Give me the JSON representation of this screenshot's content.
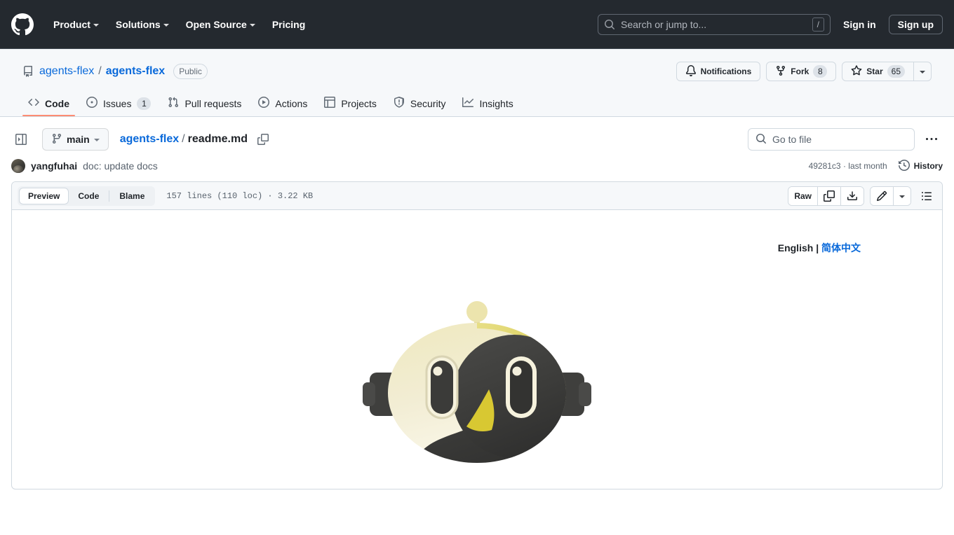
{
  "global_header": {
    "logo_icon": "github-mark-icon",
    "nav": [
      {
        "label": "Product",
        "has_caret": true
      },
      {
        "label": "Solutions",
        "has_caret": true
      },
      {
        "label": "Open Source",
        "has_caret": true
      },
      {
        "label": "Pricing",
        "has_caret": false
      }
    ],
    "search": {
      "placeholder": "Search or jump to...",
      "shortcut": "/",
      "icon": "search-icon"
    },
    "sign_in": "Sign in",
    "sign_up": "Sign up"
  },
  "repo": {
    "icon": "repo-icon",
    "owner": "agents-flex",
    "separator": "/",
    "name": "agents-flex",
    "visibility": "Public",
    "actions": {
      "notifications": {
        "label": "Notifications",
        "icon": "bell-icon"
      },
      "fork": {
        "label": "Fork",
        "count": "8",
        "icon": "fork-icon"
      },
      "star": {
        "label": "Star",
        "count": "65",
        "icon": "star-icon"
      },
      "star_caret": "star-dropdown-caret"
    },
    "tabs": [
      {
        "label": "Code",
        "icon": "code-icon",
        "active": true
      },
      {
        "label": "Issues",
        "icon": "issue-opened-icon",
        "count": "1"
      },
      {
        "label": "Pull requests",
        "icon": "git-pull-request-icon"
      },
      {
        "label": "Actions",
        "icon": "play-icon"
      },
      {
        "label": "Projects",
        "icon": "table-icon"
      },
      {
        "label": "Security",
        "icon": "shield-icon"
      },
      {
        "label": "Insights",
        "icon": "graph-icon"
      }
    ]
  },
  "file_nav": {
    "sidebar_toggle_icon": "sidebar-expand-icon",
    "branch": {
      "label": "main",
      "icon": "git-branch-icon",
      "caret": "chevron-down-icon"
    },
    "breadcrumb": {
      "root": "agents-flex",
      "separator": "/",
      "current": "readme.md"
    },
    "copy_path_icon": "copy-icon",
    "go_to_file": {
      "placeholder": "Go to file",
      "icon": "search-icon"
    },
    "more_options": "kebab-horizontal-icon"
  },
  "commit": {
    "avatar": "author-avatar",
    "author": "yangfuhai",
    "message": "doc: update docs",
    "sha": "49281c3",
    "sha_separator": "·",
    "relative_time": "last month",
    "history_label": "History",
    "history_icon": "history-icon"
  },
  "file_view": {
    "tabs": [
      {
        "label": "Preview",
        "active": true
      },
      {
        "label": "Code",
        "active": false
      },
      {
        "label": "Blame",
        "active": false
      }
    ],
    "meta": "157 lines (110 loc) · 3.22 KB",
    "raw_label": "Raw",
    "copy_icon": "copy-raw-icon",
    "download_icon": "download-icon",
    "edit_icon": "pencil-icon",
    "edit_caret_icon": "chevron-down-icon",
    "outline_icon": "list-unordered-icon"
  },
  "readme": {
    "language_switch": {
      "current": "English",
      "divider": "|",
      "alternate": "简体中文"
    },
    "logo_alt": "agents-flex robot logo"
  },
  "colors": {
    "header_bg": "#24292f",
    "repo_header_bg": "#f6f8fa",
    "link": "#0969da",
    "active_tab_underline": "#fd8c73",
    "border": "#d1d9e0",
    "muted_text": "#59636e",
    "logo_cream": "#f0ead0",
    "logo_yellow": "#d8c832",
    "logo_dark": "#3d3d3d"
  }
}
